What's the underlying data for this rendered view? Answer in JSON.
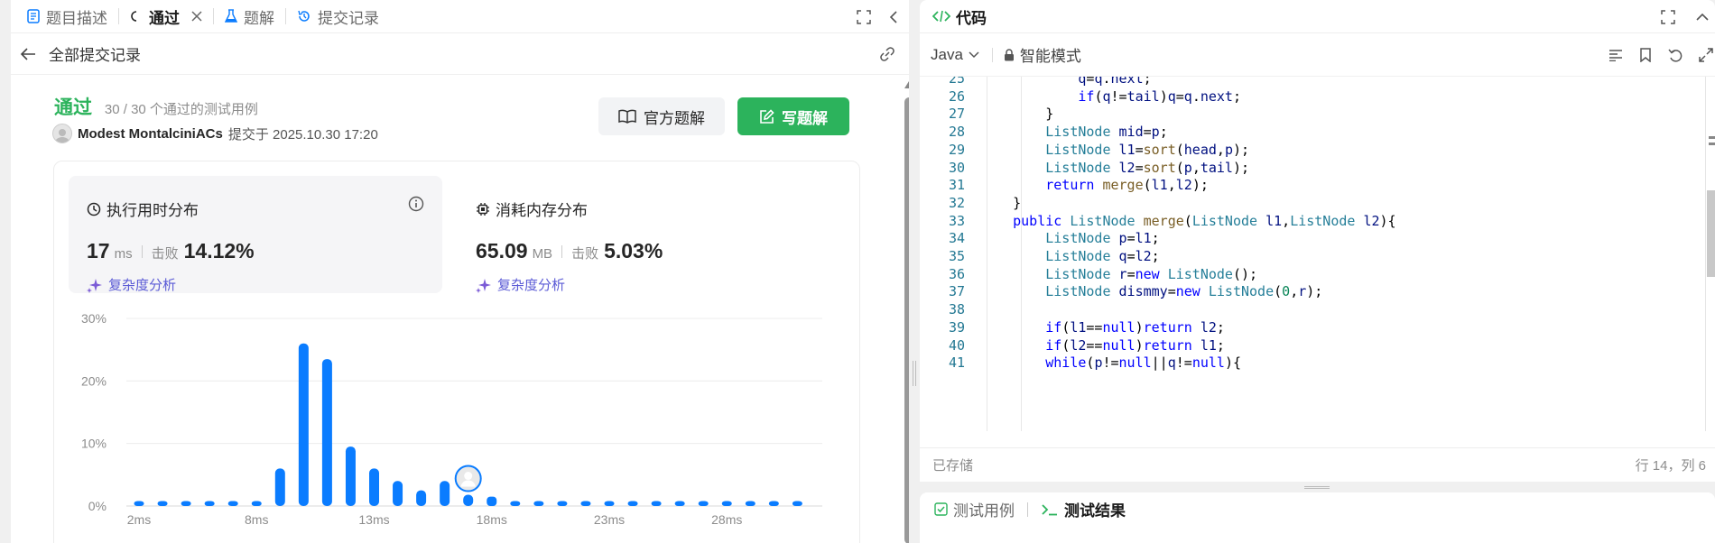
{
  "left_tabs": [
    {
      "label": "题目描述",
      "icon": "document-icon"
    },
    {
      "label": "通过",
      "icon": "status-icon",
      "active": true
    },
    {
      "label": "题解",
      "icon": "flask-icon"
    },
    {
      "label": "提交记录",
      "icon": "history-icon"
    }
  ],
  "subheader": {
    "title": "全部提交记录"
  },
  "submission": {
    "status": "通过",
    "testcases": "30 / 30 个通过的测试用例",
    "author": "Modest MontalciniACs",
    "submitted_label": "提交于 2025.10.30 17:20"
  },
  "buttons": {
    "official": "官方题解",
    "write": "写题解"
  },
  "runtime": {
    "title": "执行用时分布",
    "value": "17",
    "unit": "ms",
    "beats_label": "击败",
    "beats": "14.12%",
    "link": "复杂度分析"
  },
  "memory": {
    "title": "消耗内存分布",
    "value": "65.09",
    "unit": "MB",
    "beats_label": "击败",
    "beats": "5.03%",
    "link": "复杂度分析"
  },
  "colors": {
    "accent_green": "#2cb35c",
    "bar_blue": "#0a7cff",
    "link_purple": "#5b5bd6"
  },
  "chart_data": {
    "type": "bar",
    "ylim": [
      0,
      30
    ],
    "y_ticks": [
      "0%",
      "10%",
      "20%",
      "30%"
    ],
    "x_tick_labels": [
      "2ms",
      "8ms",
      "13ms",
      "18ms",
      "23ms",
      "28ms"
    ],
    "x_tick_positions": [
      0,
      5,
      10,
      15,
      20,
      25
    ],
    "values": [
      0.8,
      0.8,
      0.8,
      0.8,
      0.8,
      0.8,
      6.0,
      26.0,
      23.5,
      9.5,
      6.0,
      4.0,
      2.5,
      4.0,
      1.8,
      1.5,
      0.8,
      0.8,
      0.8,
      0.8,
      0.8,
      0.8,
      0.8,
      0.8,
      0.8,
      0.8,
      0.8,
      0.8,
      0.8
    ],
    "grid": true,
    "marker_index": 14
  },
  "editor": {
    "title": "代码",
    "language": "Java",
    "mode": "智能模式",
    "saved": "已存储",
    "cursor": "行 14，列 6"
  },
  "code_lines": [
    {
      "n": "25",
      "t": "            q=q.next;"
    },
    {
      "n": "26",
      "t": "            if(q!=tail)q=q.next;"
    },
    {
      "n": "27",
      "t": "        }"
    },
    {
      "n": "28",
      "t": "        ListNode mid=p;"
    },
    {
      "n": "29",
      "t": "        ListNode l1=sort(head,p);"
    },
    {
      "n": "30",
      "t": "        ListNode l2=sort(p,tail);"
    },
    {
      "n": "31",
      "t": "        return merge(l1,l2);"
    },
    {
      "n": "32",
      "t": "    }"
    },
    {
      "n": "33",
      "t": "    public ListNode merge(ListNode l1,ListNode l2){"
    },
    {
      "n": "34",
      "t": "        ListNode p=l1;"
    },
    {
      "n": "35",
      "t": "        ListNode q=l2;"
    },
    {
      "n": "36",
      "t": "        ListNode r=new ListNode();"
    },
    {
      "n": "37",
      "t": "        ListNode dismmy=new ListNode(0,r);"
    },
    {
      "n": "38",
      "t": ""
    },
    {
      "n": "39",
      "t": "        if(l1==null)return l2;"
    },
    {
      "n": "40",
      "t": "        if(l2==null)return l1;"
    },
    {
      "n": "41",
      "t": "        while(p!=null||q!=null){"
    }
  ],
  "bottom_tabs": [
    {
      "label": "测试用例",
      "icon": "checkbox-icon"
    },
    {
      "label": "测试结果",
      "icon": "terminal-icon",
      "active": true
    }
  ]
}
